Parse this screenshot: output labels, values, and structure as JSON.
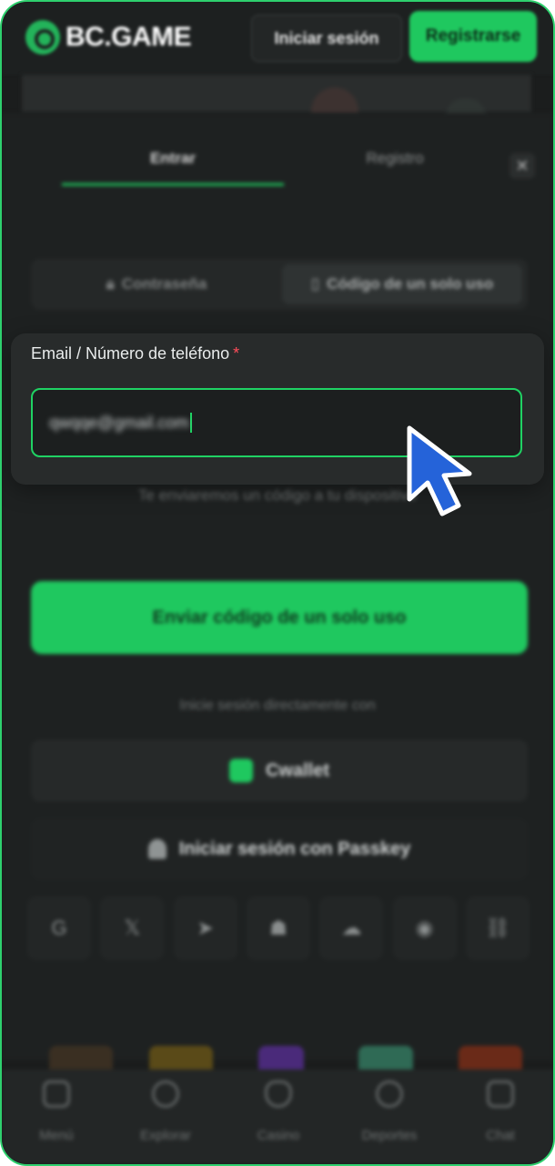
{
  "header": {
    "brand": "BC.GAME",
    "login_label": "Iniciar sesión",
    "register_label": "Registrarse"
  },
  "modal": {
    "tabs": [
      {
        "label": "Entrar",
        "active": true
      },
      {
        "label": "Registro",
        "active": false
      }
    ],
    "close_icon": "close-icon",
    "auth_modes": [
      {
        "label": "Contraseña",
        "icon": "lock-icon",
        "active": false
      },
      {
        "label": "Código de un solo uso",
        "icon": "phone-icon",
        "active": true
      }
    ],
    "email_field": {
      "label": "Email / Número de teléfono",
      "required_mark": "*",
      "value": "qwqqe@gmail.com"
    },
    "helper_text": "Te enviaremos un código a tu dispositivo",
    "send_button": "Enviar código de un solo uso",
    "direct_login_text": "Inicie sesión directamente con",
    "cwallet_label": "Cwallet",
    "passkey_label": "Iniciar sesión con Passkey",
    "social_icons": [
      "google-icon",
      "x-icon",
      "telegram-icon",
      "steam-icon",
      "cloud-icon",
      "whatsapp-icon",
      "link-icon"
    ]
  },
  "bottom_nav": [
    {
      "label": "Menú",
      "icon": "menu-icon"
    },
    {
      "label": "Explorar",
      "icon": "explore-icon"
    },
    {
      "label": "Casino",
      "icon": "casino-icon"
    },
    {
      "label": "Deportes",
      "icon": "sports-icon"
    },
    {
      "label": "Chat",
      "icon": "chat-icon"
    }
  ],
  "colors": {
    "accent": "#1fc85f",
    "background": "#1b1d1d",
    "required": "#ff4d5a",
    "pointer": "#2563d9"
  }
}
